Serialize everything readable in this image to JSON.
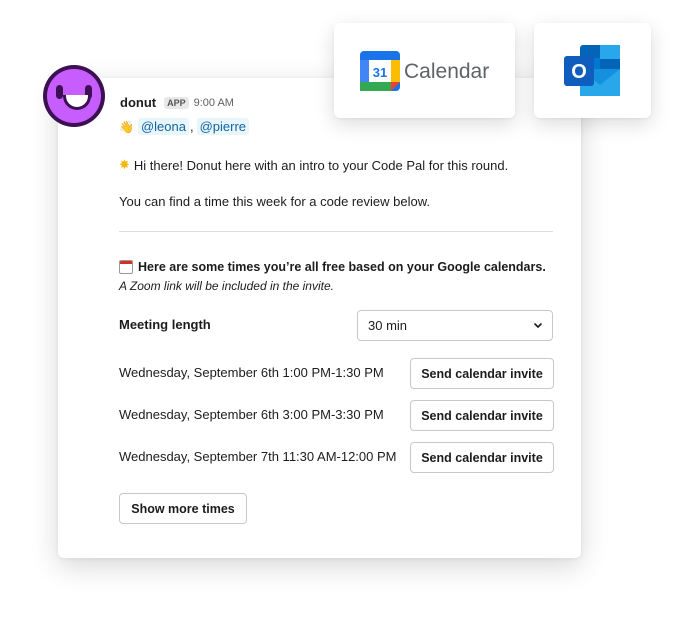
{
  "integrations": {
    "google_calendar": {
      "label": "Calendar",
      "icon_date": "31",
      "icon": "google-calendar-icon"
    },
    "outlook": {
      "icon": "outlook-icon",
      "letter": "O"
    }
  },
  "message": {
    "sender": "donut",
    "badge": "APP",
    "time": "9:00 AM",
    "mentions": [
      "@leona",
      "@pierre"
    ],
    "intro": "Hi there! Donut here with an intro to your Code Pal for this round.",
    "prompt": "You can find a time this week for a code review below.",
    "times_title": "Here are some times you’re all free based on your Google calendars.",
    "zoom_note": "A Zoom link will be included in the invite.",
    "meeting_length_label": "Meeting length",
    "meeting_length_value": "30 min",
    "slots": [
      {
        "time": "Wednesday, September 6th 1:00 PM-1:30 PM",
        "button": "Send calendar invite"
      },
      {
        "time": "Wednesday, September 6th 3:00 PM-3:30 PM",
        "button": "Send calendar invite"
      },
      {
        "time": "Wednesday, September 7th 11:30 AM-12:00 PM",
        "button": "Send calendar invite"
      }
    ],
    "show_more": "Show more times"
  },
  "colors": {
    "avatar_outer": "#3c1053",
    "avatar_inner": "#c65dfc",
    "mention_bg": "#e8f5fa",
    "mention_text": "#1264a3"
  }
}
